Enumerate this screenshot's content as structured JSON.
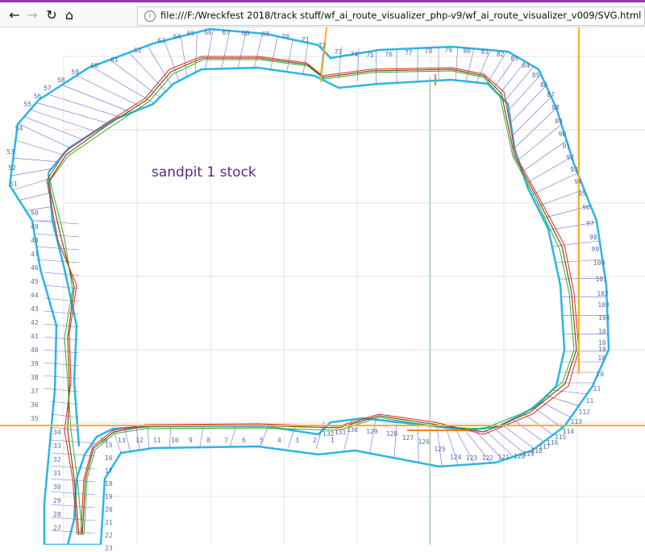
{
  "browser": {
    "url": "file:///F:/Wreckfest 2018/track stuff/wf_ai_route_visualizer_php-v9/wf_ai_route_visualizer_v009/SVG.html",
    "info_icon": "info-icon",
    "back_icon": "arrow-left-icon",
    "forward_icon": "arrow-right-icon",
    "reload_icon": "reload-icon",
    "home_icon": "home-icon"
  },
  "map": {
    "title": "sandpit 1 stock",
    "colors": {
      "outline": "#29b6e8",
      "sector": "#6a6ad8",
      "route_red": "#d22",
      "route_green": "#3a3",
      "route_dark": "#7a5010",
      "guide": "#f5b020",
      "grid": "#cfcfcf"
    },
    "upper_labels": [
      "51",
      "52",
      "53",
      "54",
      "55",
      "56",
      "57",
      "58",
      "59",
      "60",
      "61",
      "62",
      "63",
      "64",
      "65",
      "66",
      "67",
      "68",
      "69",
      "70",
      "71",
      "72",
      "73",
      "74",
      "75",
      "76",
      "77",
      "78",
      "79",
      "80",
      "81",
      "82",
      "83",
      "84",
      "85",
      "86",
      "87",
      "88",
      "89",
      "90",
      "91",
      "92",
      "93",
      "94",
      "95",
      "96",
      "97",
      "98",
      "99",
      "100",
      "101",
      "102",
      "103",
      "104",
      "10",
      "10",
      "10",
      "10",
      "10",
      "11",
      "11",
      "112",
      "113",
      "114",
      "115",
      "116",
      "117",
      "118",
      "119",
      "120",
      "121",
      "122",
      "123",
      "124",
      "125",
      "126",
      "127",
      "128",
      "129",
      "130",
      "131",
      "132"
    ],
    "left_labels": [
      "50",
      "49",
      "48",
      "47",
      "46",
      "45",
      "44",
      "43",
      "42",
      "41",
      "40",
      "39",
      "38",
      "37",
      "36",
      "35",
      "34",
      "33",
      "32",
      "31",
      "30",
      "29",
      "28",
      "27"
    ],
    "inner_labels": [
      "1",
      "2",
      "3",
      "4",
      "5",
      "6",
      "7",
      "8",
      "9",
      "10",
      "11",
      "12",
      "13",
      "14",
      "15",
      "16",
      "17",
      "18",
      "19",
      "20",
      "21",
      "22",
      "23"
    ]
  }
}
